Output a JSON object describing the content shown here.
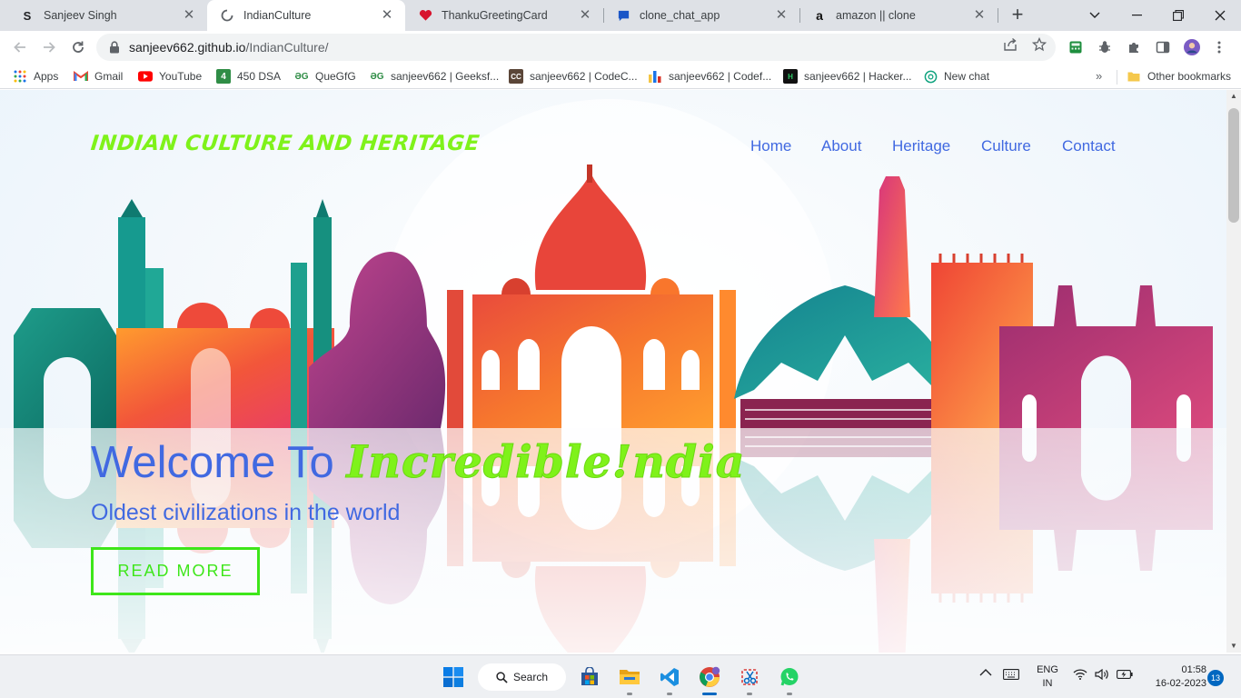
{
  "browser": {
    "tabs": [
      {
        "title": "Sanjeev Singh",
        "icon": "s-letter-icon",
        "active": false
      },
      {
        "title": "IndianCulture",
        "icon": "loading-icon",
        "active": true
      },
      {
        "title": "ThankuGreetingCard",
        "icon": "heart-icon",
        "active": false
      },
      {
        "title": "clone_chat_app",
        "icon": "chat-bubble-icon",
        "active": false
      },
      {
        "title": "amazon || clone",
        "icon": "amazon-icon",
        "active": false
      }
    ],
    "url_host": "sanjeev662.github.io",
    "url_path": "/IndianCulture/",
    "bookmarks": [
      {
        "label": "Apps",
        "icon": "apps-grid-icon"
      },
      {
        "label": "Gmail",
        "icon": "gmail-icon"
      },
      {
        "label": "YouTube",
        "icon": "youtube-icon"
      },
      {
        "label": "450 DSA",
        "icon": "number-4-icon"
      },
      {
        "label": "QueGfG",
        "icon": "gfg-icon"
      },
      {
        "label": "sanjeev662 | Geeksf...",
        "icon": "gfg-icon"
      },
      {
        "label": "sanjeev662 | CodeC...",
        "icon": "codechef-icon"
      },
      {
        "label": "sanjeev662 | Codef...",
        "icon": "codeforces-icon"
      },
      {
        "label": "sanjeev662 | Hacker...",
        "icon": "hackerrank-icon"
      },
      {
        "label": "New chat",
        "icon": "openai-icon"
      }
    ],
    "bookmarks_overflow": "»",
    "other_bookmarks": "Other bookmarks"
  },
  "site": {
    "logo": "INDIAN CULTURE AND HERITAGE",
    "nav": [
      "Home",
      "About",
      "Heritage",
      "Culture",
      "Contact"
    ],
    "hero_prefix": "Welcome To ",
    "hero_accent": "Incredible!ndia",
    "subtitle": "Oldest civilizations in the world",
    "cta": "READ MORE"
  },
  "taskbar": {
    "search_label": "Search",
    "apps": [
      "windows-start-icon",
      "search-icon",
      "microsoft-store-icon",
      "file-explorer-icon",
      "vscode-icon",
      "chrome-icon",
      "snipping-tool-icon",
      "whatsapp-icon"
    ],
    "language": "ENG",
    "region": "IN",
    "time": "01:58",
    "date": "16-02-2023",
    "notifications": "13"
  },
  "colors": {
    "accent_blue": "#4169e1",
    "accent_green": "#7ff21a",
    "button_green": "#3ee61a"
  }
}
